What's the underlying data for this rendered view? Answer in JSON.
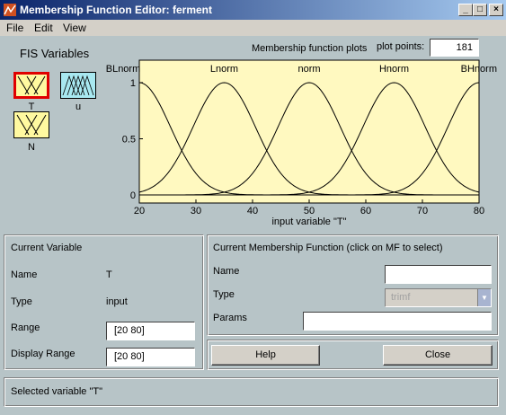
{
  "window": {
    "title": "Membership Function Editor: ferment",
    "controls": [
      "_",
      "□",
      "×"
    ]
  },
  "menu": [
    "File",
    "Edit",
    "View"
  ],
  "fis": {
    "label": "FIS Variables",
    "variables": [
      {
        "name": "T",
        "kind": "input",
        "selected": true,
        "color": "#fff9a0"
      },
      {
        "name": "u",
        "kind": "output",
        "selected": false,
        "color": "#a8e8f0"
      },
      {
        "name": "N",
        "kind": "input",
        "selected": false,
        "color": "#fff9a0"
      }
    ]
  },
  "plot_header": {
    "label": "Membership function plots",
    "points_label": "plot points:",
    "points_value": "181"
  },
  "chart_data": {
    "type": "line",
    "xlabel": "input variable \"T\"",
    "ylabel": "",
    "xlim": [
      20,
      80
    ],
    "ylim": [
      0,
      1
    ],
    "x_ticks": [
      20,
      30,
      40,
      50,
      60,
      70,
      80
    ],
    "y_ticks": [
      0,
      0.5,
      1
    ],
    "y_tick_labels": [
      "0",
      "0.5",
      "1"
    ],
    "background": "#fff9c0",
    "line_color": "#000000",
    "series": [
      {
        "name": "BLnorm",
        "shape": "gauss",
        "center": 20,
        "sigma": 5.5
      },
      {
        "name": "Lnorm",
        "shape": "gauss",
        "center": 35,
        "sigma": 5.5
      },
      {
        "name": "norm",
        "shape": "gauss",
        "center": 50,
        "sigma": 5.5
      },
      {
        "name": "Hnorm",
        "shape": "gauss",
        "center": 65,
        "sigma": 5.5
      },
      {
        "name": "BHnorm",
        "shape": "gauss",
        "center": 80,
        "sigma": 5.5
      }
    ]
  },
  "current_variable": {
    "title": "Current Variable",
    "name_label": "Name",
    "name_value": "T",
    "type_label": "Type",
    "type_value": "input",
    "range_label": "Range",
    "range_value": "[20 80]",
    "display_range_label": "Display Range",
    "display_range_value": "[20 80]"
  },
  "current_mf": {
    "title": "Current Membership Function (click on MF to select)",
    "name_label": "Name",
    "name_value": "",
    "type_label": "Type",
    "type_value": "trimf",
    "params_label": "Params",
    "params_value": ""
  },
  "buttons": {
    "help": "Help",
    "close": "Close"
  },
  "status": "Selected variable \"T\""
}
